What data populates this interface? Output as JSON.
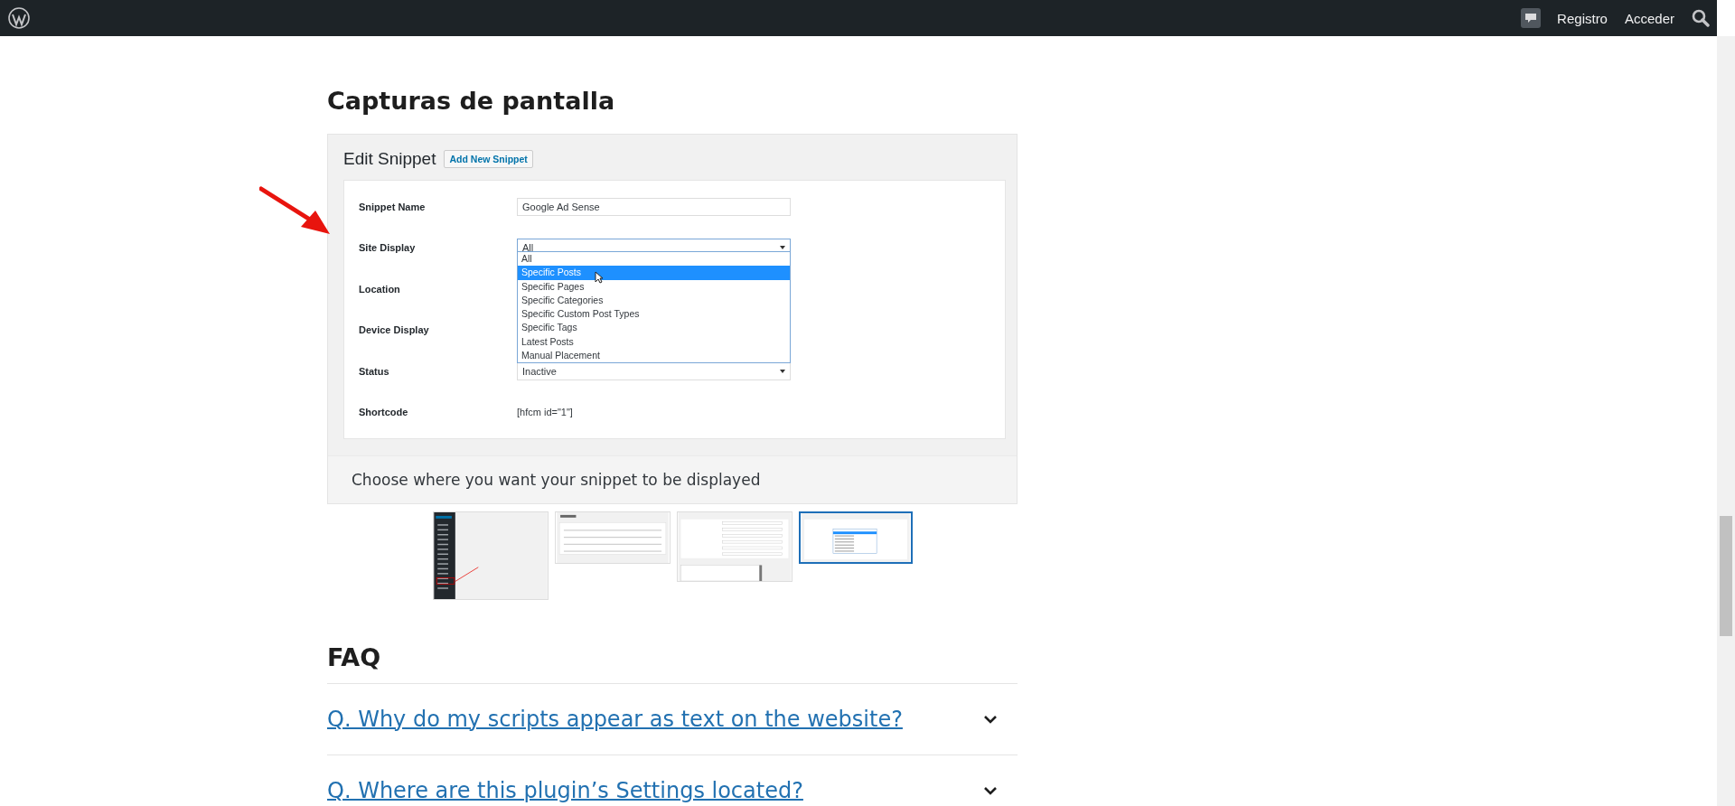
{
  "admin_bar": {
    "links": [
      "Registro",
      "Acceder"
    ]
  },
  "screenshots": {
    "heading": "Capturas de pantalla",
    "current": {
      "title": "Edit Snippet",
      "button": "Add New Snippet",
      "rows": [
        {
          "label": "Snippet Name",
          "kind": "input",
          "value": "Google Ad Sense"
        },
        {
          "label": "Site Display",
          "kind": "select",
          "value": "All"
        },
        {
          "label": "Location",
          "kind": "hidden"
        },
        {
          "label": "Device Display",
          "kind": "hidden"
        },
        {
          "label": "Status",
          "kind": "select",
          "value": "Inactive"
        },
        {
          "label": "Shortcode",
          "kind": "text",
          "value": "[hfcm id=\"1\"]"
        }
      ],
      "dropdown": [
        {
          "label": "All",
          "selected": false
        },
        {
          "label": "Specific Posts",
          "selected": true
        },
        {
          "label": "Specific Pages",
          "selected": false
        },
        {
          "label": "Specific Categories",
          "selected": false
        },
        {
          "label": "Specific Custom Post Types",
          "selected": false
        },
        {
          "label": "Specific Tags",
          "selected": false
        },
        {
          "label": "Latest Posts",
          "selected": false
        },
        {
          "label": "Manual Placement",
          "selected": false
        }
      ],
      "caption": "Choose where you want your snippet to be displayed"
    },
    "thumbnails": [
      {
        "kind": "menu",
        "selected": false
      },
      {
        "kind": "table",
        "selected": false
      },
      {
        "kind": "form",
        "selected": false
      },
      {
        "kind": "dropdown",
        "selected": true
      }
    ]
  },
  "faq": {
    "heading": "FAQ",
    "items": [
      {
        "question": "Q. Why do my scripts appear as text on the website?",
        "expanded": false
      },
      {
        "question": "Q. Where are this plugin’s Settings located?",
        "expanded": false
      }
    ]
  }
}
